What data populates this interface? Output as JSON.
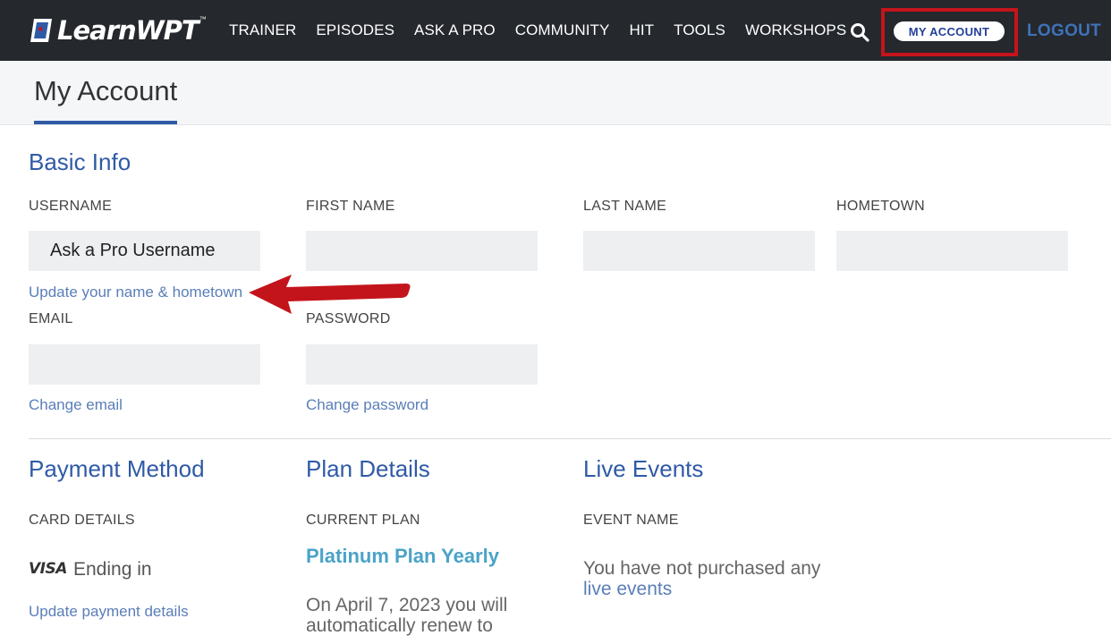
{
  "brand": {
    "logo_text": "LearnWPT",
    "trademark": "™"
  },
  "nav": {
    "items": [
      "TRAINER",
      "EPISODES",
      "ASK A PRO",
      "COMMUNITY",
      "HIT",
      "TOOLS",
      "WORKSHOPS"
    ],
    "my_account": "MY ACCOUNT",
    "logout": "LOGOUT"
  },
  "page": {
    "title": "My Account"
  },
  "basic_info": {
    "title": "Basic Info",
    "username_label": "USERNAME",
    "username_value": "Ask a Pro Username",
    "first_name_label": "FIRST NAME",
    "first_name_value": "",
    "last_name_label": "LAST NAME",
    "last_name_value": "",
    "hometown_label": "HOMETOWN",
    "hometown_value": "",
    "update_link": "Update your name & hometown",
    "email_label": "EMAIL",
    "email_value": "",
    "password_label": "PASSWORD",
    "password_value": "",
    "change_email": "Change email",
    "change_password": "Change password"
  },
  "payment": {
    "title": "Payment Method",
    "card_label": "CARD DETAILS",
    "card_brand": "VISA",
    "ending_text": "Ending in",
    "update_link": "Update payment details"
  },
  "plan": {
    "title": "Plan Details",
    "current_label": "CURRENT PLAN",
    "plan_name": "Platinum Plan Yearly",
    "renew_text": "On April 7, 2023 you will automatically renew to"
  },
  "events": {
    "title": "Live Events",
    "event_label": "EVENT NAME",
    "empty_text": "You have not purchased any",
    "empty_link": "live events"
  },
  "colors": {
    "nav_bg": "#25282d",
    "accent_blue": "#2f5aa6",
    "link_blue": "#5a7eb8",
    "plan_teal": "#4aa3c8",
    "highlight_red": "#c4141b"
  }
}
